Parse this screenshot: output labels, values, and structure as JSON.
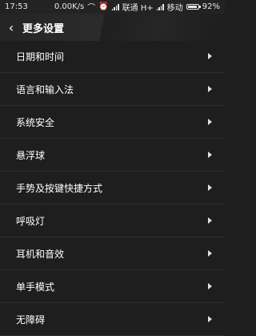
{
  "statusbar": {
    "time": "17:53",
    "speed": "0.00K/s",
    "carrier1": "联通 H+",
    "carrier2": "移动",
    "battery": "92%",
    "battery_level": 0.92
  },
  "header": {
    "title": "更多设置"
  },
  "items": [
    {
      "label": "日期和时间"
    },
    {
      "label": "语言和输入法"
    },
    {
      "label": "系统安全"
    },
    {
      "label": "悬浮球"
    },
    {
      "label": "手势及按键快捷方式"
    },
    {
      "label": "呼吸灯"
    },
    {
      "label": "耳机和音效"
    },
    {
      "label": "单手模式"
    },
    {
      "label": "无障碍"
    }
  ]
}
